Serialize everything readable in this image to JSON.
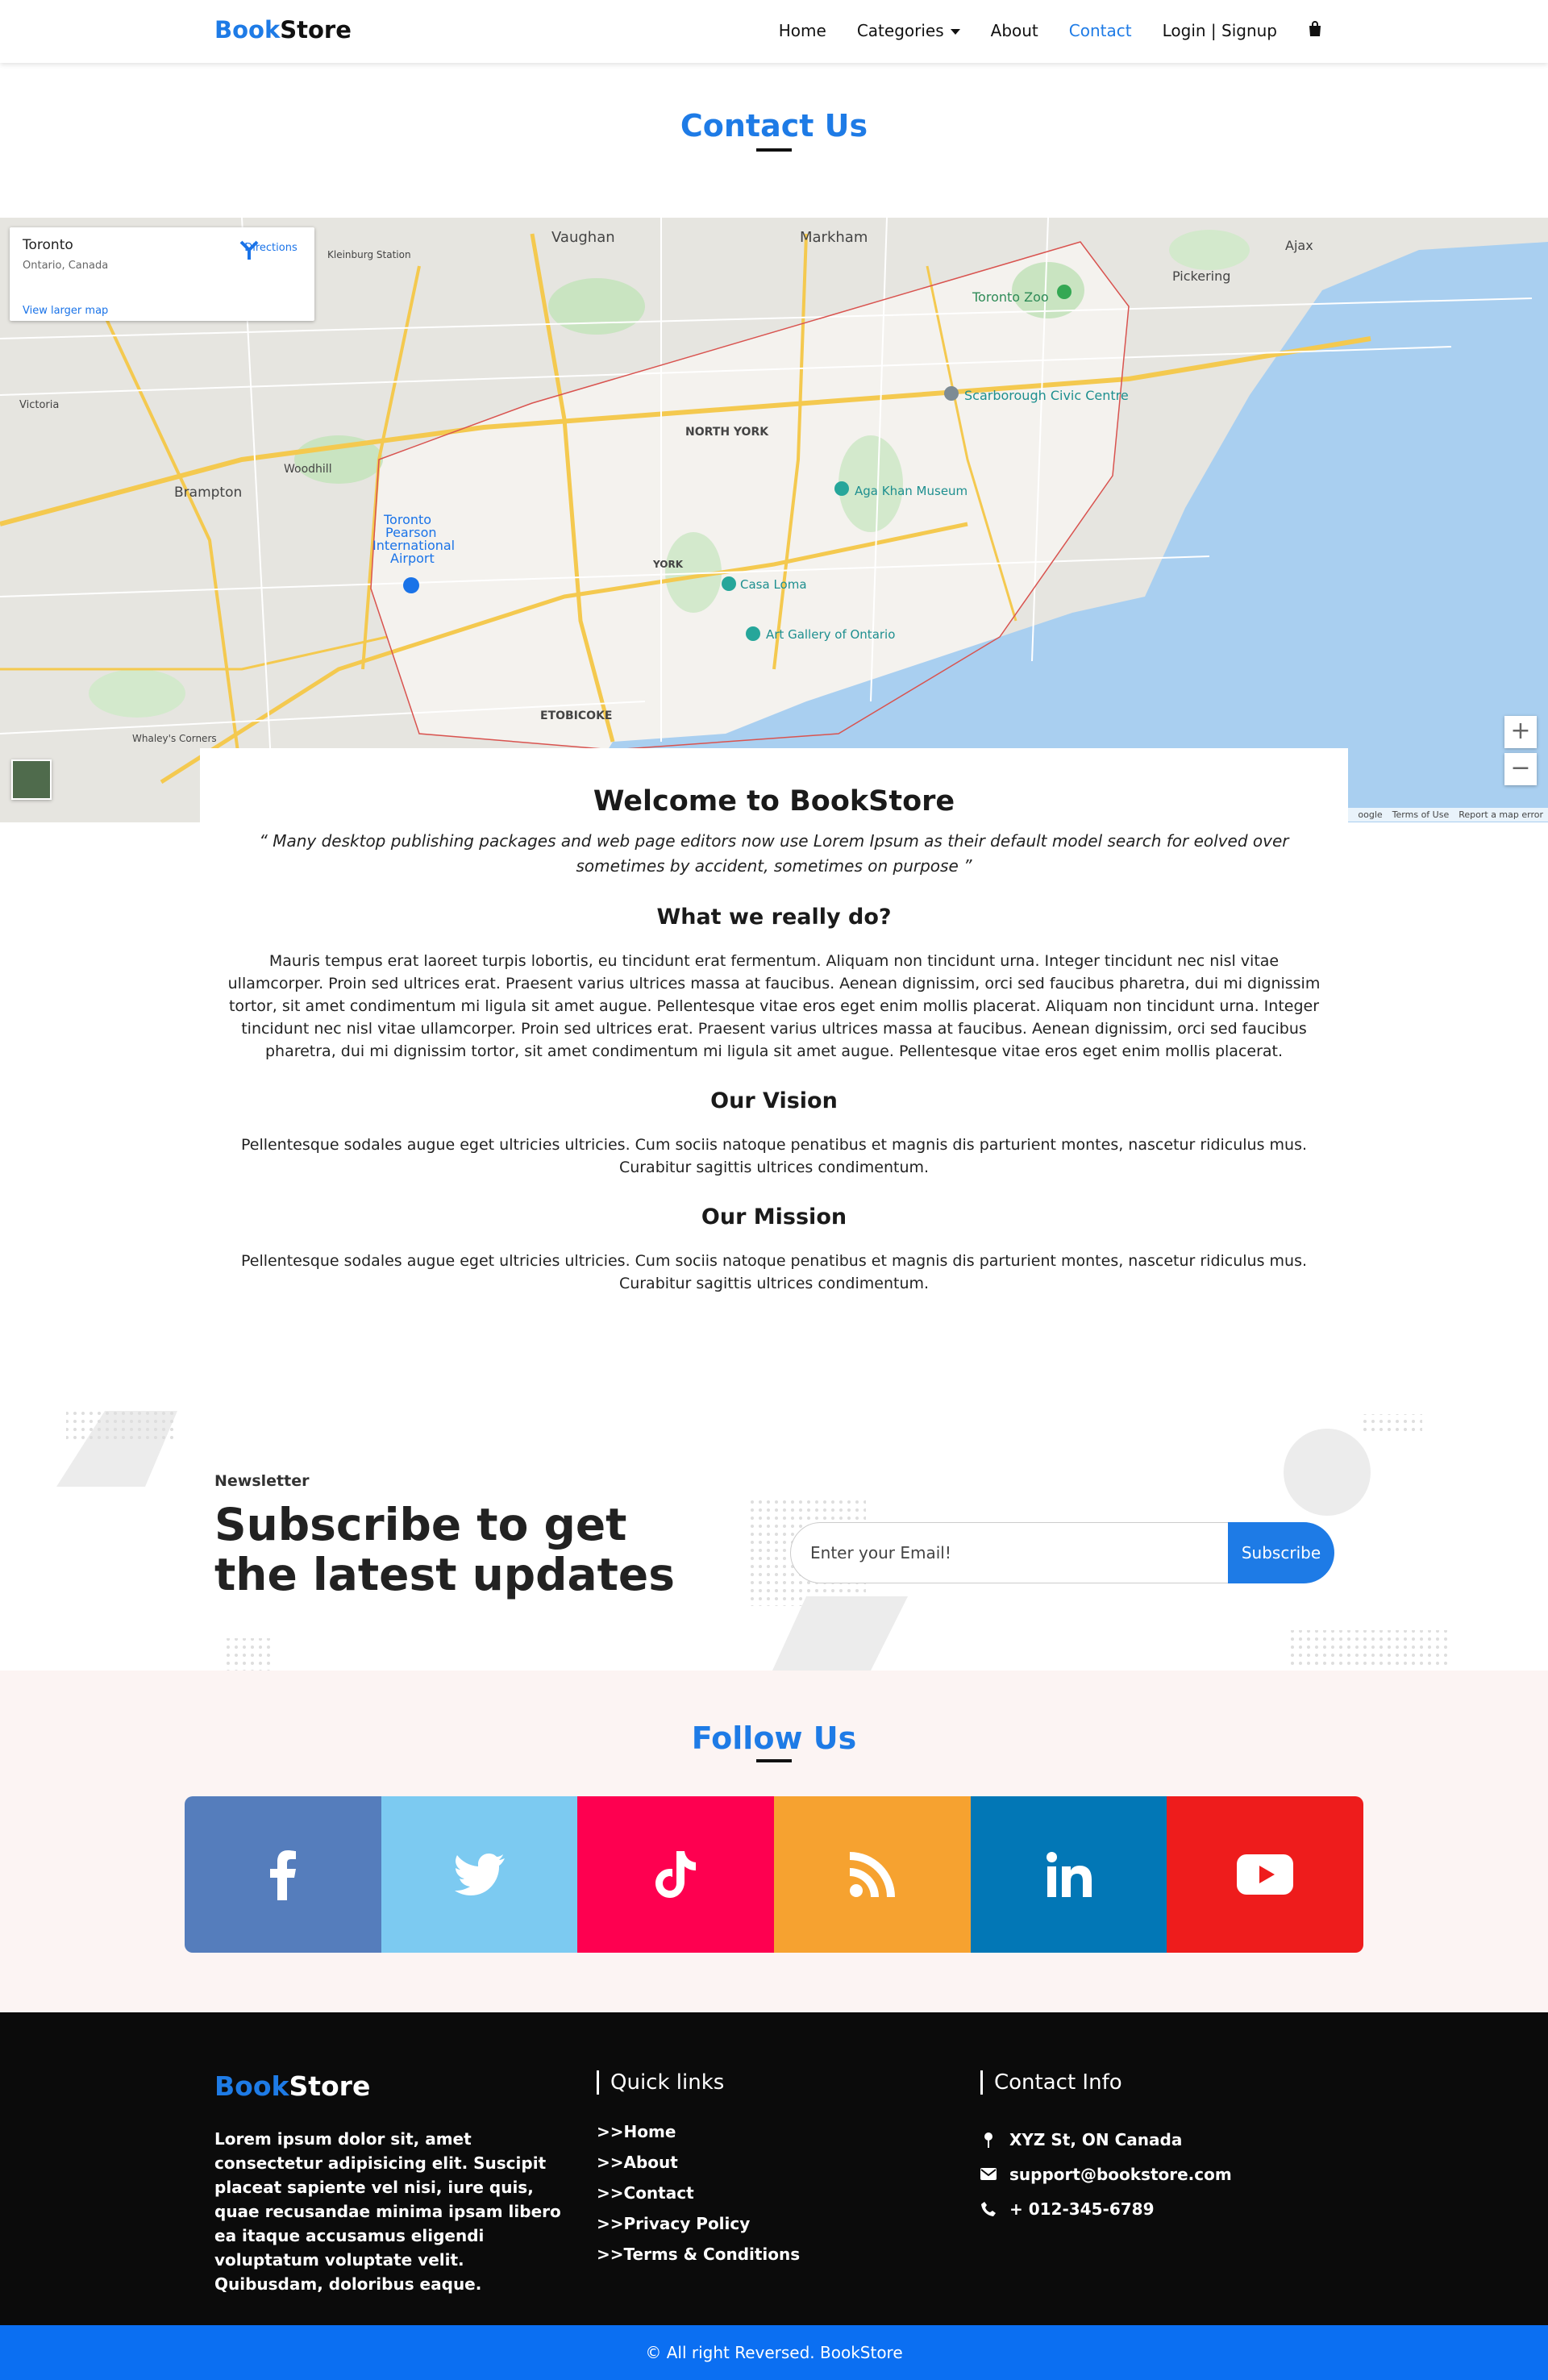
{
  "nav": {
    "brand_first": "Book",
    "brand_second": "Store",
    "links": [
      "Home",
      "Categories",
      "About",
      "Contact",
      "Login | Signup"
    ],
    "active_link": "Contact",
    "accent_color": "#1e7be6"
  },
  "contact_title": "Contact Us",
  "map": {
    "place_name": "Toronto",
    "place_region": "Ontario, Canada",
    "directions_label": "Directions",
    "view_larger": "View larger map",
    "zoom_in": "+",
    "zoom_out": "−",
    "footer_links": [
      "oogle",
      "Terms of Use",
      "Report a map error"
    ],
    "labels": [
      "Vaughan",
      "Markham",
      "Pickering",
      "Ajax",
      "Toronto Zoo",
      "Scarborough Civic Centre",
      "NORTH YORK",
      "Brampton",
      "Toronto Pearson International Airport",
      "Aga Khan Museum",
      "Casa Loma",
      "Art Gallery of Ontario",
      "ETOBICOKE",
      "YORK",
      "Woodhill",
      "Kleinburg Station",
      "Victoria",
      "Whaley's Corners"
    ]
  },
  "about": {
    "heading": "Welcome to BookStore",
    "quote": "“ Many desktop publishing packages and web page editors now use Lorem Ipsum as their default model search for eolved over sometimes by accident, sometimes on purpose ”",
    "what_heading": "What we really do?",
    "what_text": "Mauris tempus erat laoreet turpis lobortis, eu tincidunt erat fermentum. Aliquam non tincidunt urna. Integer tincidunt nec nisl vitae ullamcorper. Proin sed ultrices erat. Praesent varius ultrices massa at faucibus. Aenean dignissim, orci sed faucibus pharetra, dui mi dignissim tortor, sit amet condimentum mi ligula sit amet augue. Pellentesque vitae eros eget enim mollis placerat. Aliquam non tincidunt urna. Integer tincidunt nec nisl vitae ullamcorper. Proin sed ultrices erat. Praesent varius ultrices massa at faucibus. Aenean dignissim, orci sed faucibus pharetra, dui mi dignissim tortor, sit amet condimentum mi ligula sit amet augue. Pellentesque vitae eros eget enim mollis placerat.",
    "vision_heading": "Our Vision",
    "vision_text": "Pellentesque sodales augue eget ultricies ultricies. Cum sociis natoque penatibus et magnis dis parturient montes, nascetur ridiculus mus. Curabitur sagittis ultrices condimentum.",
    "mission_heading": "Our Mission",
    "mission_text": "Pellentesque sodales augue eget ultricies ultricies. Cum sociis natoque penatibus et magnis dis parturient montes, nascetur ridiculus mus. Curabitur sagittis ultrices condimentum."
  },
  "newsletter": {
    "kicker": "Newsletter",
    "title": "Subscribe to get the latest updates",
    "placeholder": "Enter your Email!",
    "button": "Subscribe"
  },
  "follow": {
    "title": "Follow Us",
    "networks": [
      {
        "name": "facebook",
        "icon": "facebook-icon",
        "color": "#557dbc"
      },
      {
        "name": "twitter",
        "icon": "twitter-icon",
        "color": "#7ccaf1"
      },
      {
        "name": "tiktok",
        "icon": "tiktok-icon",
        "color": "#fe0050"
      },
      {
        "name": "rss",
        "icon": "rss-icon",
        "color": "#f6a230"
      },
      {
        "name": "linkedin",
        "icon": "linkedin-icon",
        "color": "#0277b6"
      },
      {
        "name": "youtube",
        "icon": "youtube-icon",
        "color": "#ee1c1c"
      }
    ]
  },
  "footer": {
    "brand_first": "Book",
    "brand_second": "Store",
    "about_text": "Lorem ipsum dolor sit, amet consectetur adipisicing elit. Suscipit placeat sapiente vel nisi, iure quis, quae recusandae minima ipsam libero ea itaque accusamus eligendi voluptatum voluptate velit. Quibusdam, doloribus eaque.",
    "quick_links_title": "Quick links",
    "quick_links": [
      ">>Home",
      ">>About",
      ">>Contact",
      ">>Privacy Policy",
      ">>Terms & Conditions"
    ],
    "contact_title": "Contact Info",
    "address": "XYZ St, ON Canada",
    "email": "support@bookstore.com",
    "phone": "+ 012-345-6789",
    "copyright": "© All right Reversed.  BookStore"
  }
}
